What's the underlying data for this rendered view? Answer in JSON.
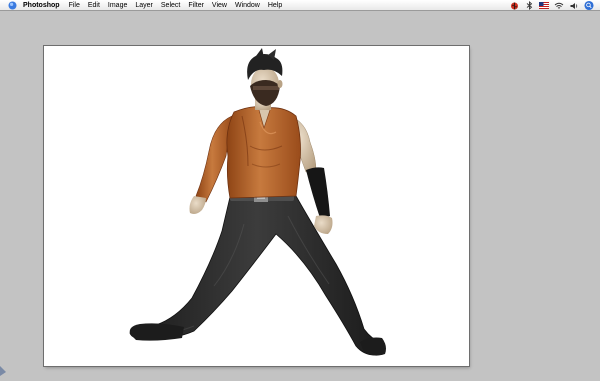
{
  "menubar": {
    "app_name": "Photoshop",
    "menus": [
      "File",
      "Edit",
      "Image",
      "Layer",
      "Select",
      "Filter",
      "View",
      "Window",
      "Help"
    ]
  },
  "status_icons": [
    "ladybug-icon",
    "bluetooth-icon",
    "us-flag-icon",
    "wifi-icon",
    "volume-icon",
    "spotlight-icon"
  ],
  "colors": {
    "desktop": "#c3c3c3",
    "canvas": "#ffffff",
    "shirt": "#b8642a",
    "pants": "#2a2a2a",
    "skin": "#d8c6ad",
    "hair": "#222222"
  }
}
